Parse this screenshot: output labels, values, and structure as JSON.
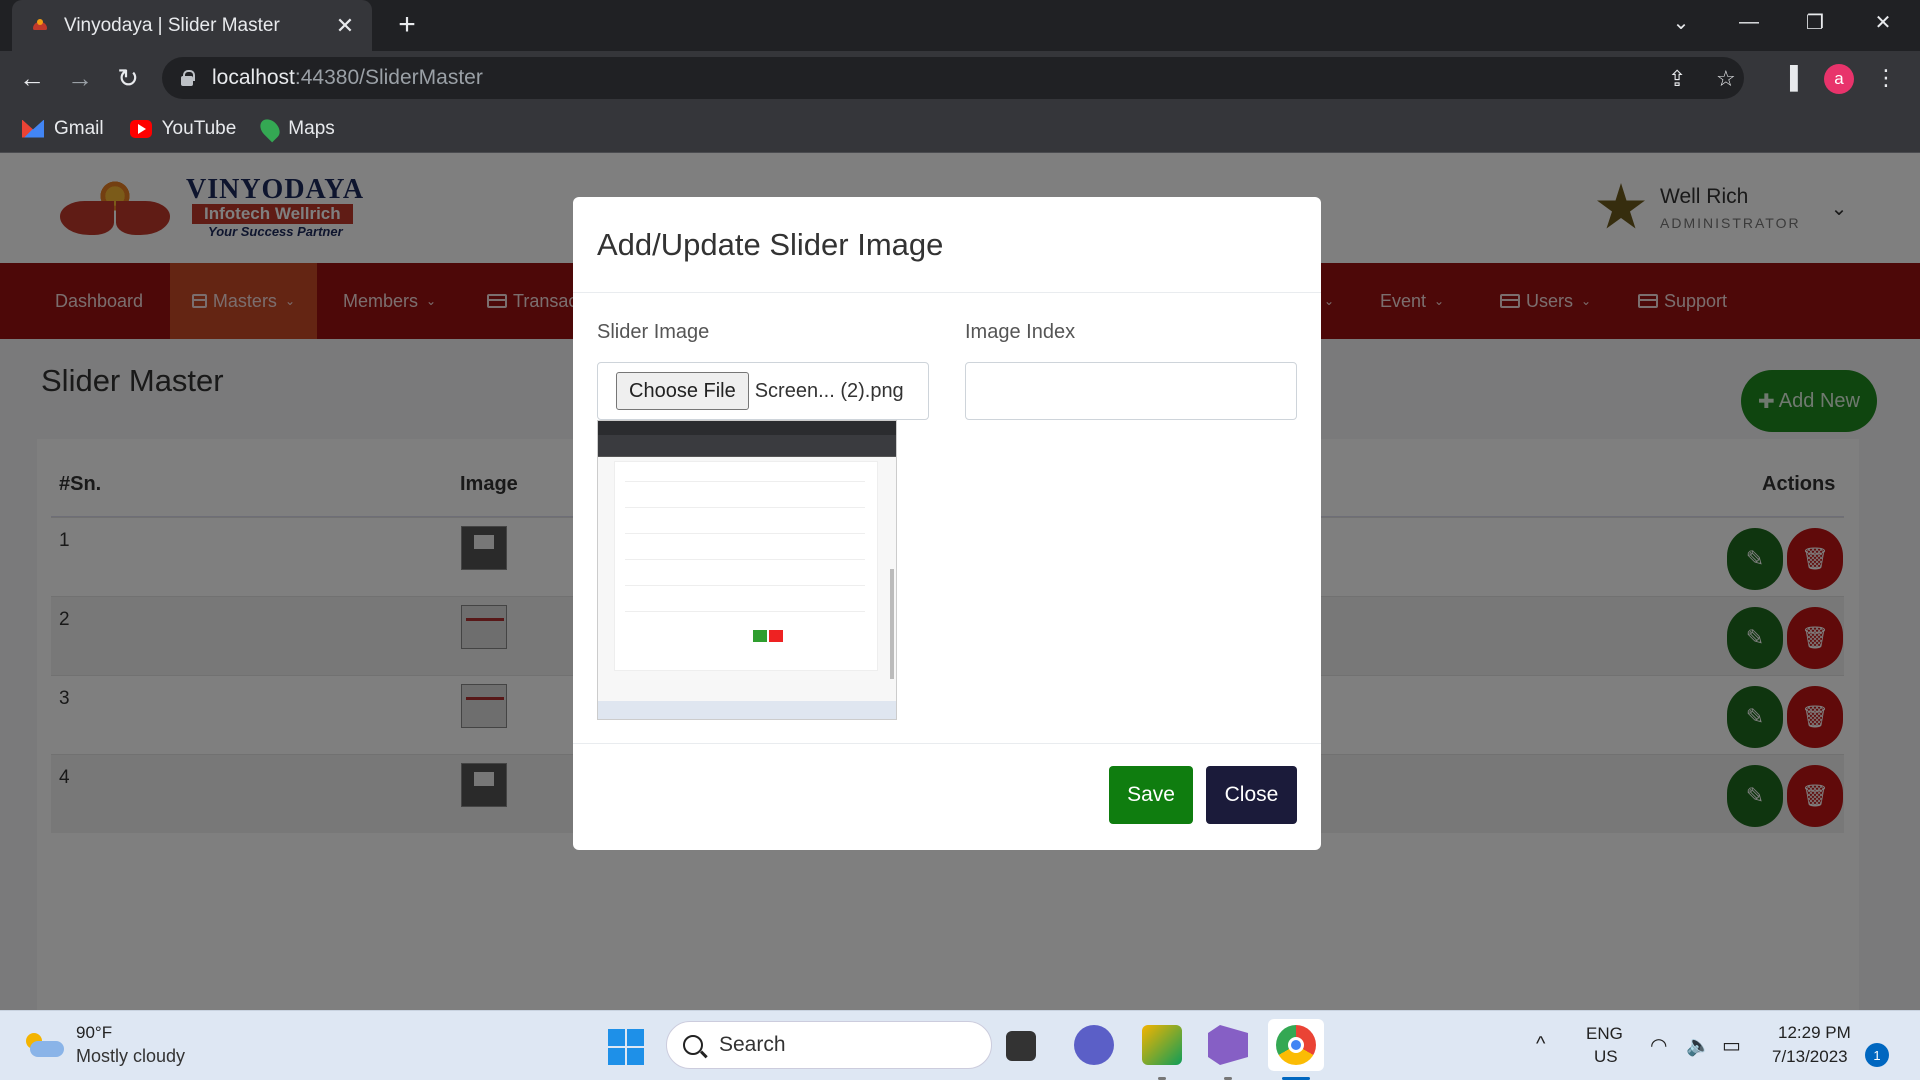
{
  "browser": {
    "tab_title": "Vinyodaya | Slider Master",
    "tab_close": "✕",
    "new_tab": "+",
    "url_host": "localhost",
    "url_path": ":44380/SliderMaster",
    "profile_initial": "a",
    "bookmarks": [
      "Gmail",
      "YouTube",
      "Maps"
    ]
  },
  "site": {
    "logo": {
      "name": "VINYODAYA",
      "sub": "Infotech Wellrich",
      "tagline": "Your Success Partner"
    },
    "user": {
      "name": "Well Rich",
      "role": "ADMINISTRATOR"
    },
    "menu": [
      {
        "label": "Dashboard",
        "has_icon": false,
        "has_caret": false,
        "active": false
      },
      {
        "label": "Masters",
        "has_icon": true,
        "has_caret": true,
        "active": true
      },
      {
        "label": "Members",
        "has_icon": false,
        "has_caret": true,
        "active": false
      },
      {
        "label": "Transac",
        "has_icon": true,
        "has_caret": false,
        "active": false
      },
      {
        "label": "Event",
        "has_icon": false,
        "has_caret": true,
        "active": false
      },
      {
        "label": "Users",
        "has_icon": true,
        "has_caret": true,
        "active": false
      },
      {
        "label": "Support",
        "has_icon": true,
        "has_caret": false,
        "active": false
      }
    ],
    "page_title": "Slider Master",
    "add_new_label": "Add New",
    "table": {
      "headers": {
        "sn": "#Sn.",
        "image": "Image",
        "actions": "Actions"
      },
      "rows": [
        {
          "sn": "1",
          "thumb": "dark"
        },
        {
          "sn": "2",
          "thumb": "light"
        },
        {
          "sn": "3",
          "thumb": "light"
        },
        {
          "sn": "4",
          "thumb": "dark"
        }
      ]
    }
  },
  "modal": {
    "title": "Add/Update Slider Image",
    "slider_image_label": "Slider Image",
    "choose_file_label": "Choose File",
    "file_name": "Screen... (2).png",
    "image_index_label": "Image Index",
    "image_index_value": "",
    "save_label": "Save",
    "close_label": "Close"
  },
  "taskbar": {
    "weather_temp": "90°F",
    "weather_desc": "Mostly cloudy",
    "search_placeholder": "Search",
    "lang_line1": "ENG",
    "lang_line2": "US",
    "time": "12:29 PM",
    "date": "7/13/2023",
    "notification_count": "1"
  },
  "colors": {
    "menu_bg": "#9b1111",
    "menu_active": "#c94a26",
    "save_green": "#0f7d0f",
    "close_navy": "#1b1b3a",
    "edit_green": "#1f6b1f",
    "delete_red": "#c01414"
  }
}
